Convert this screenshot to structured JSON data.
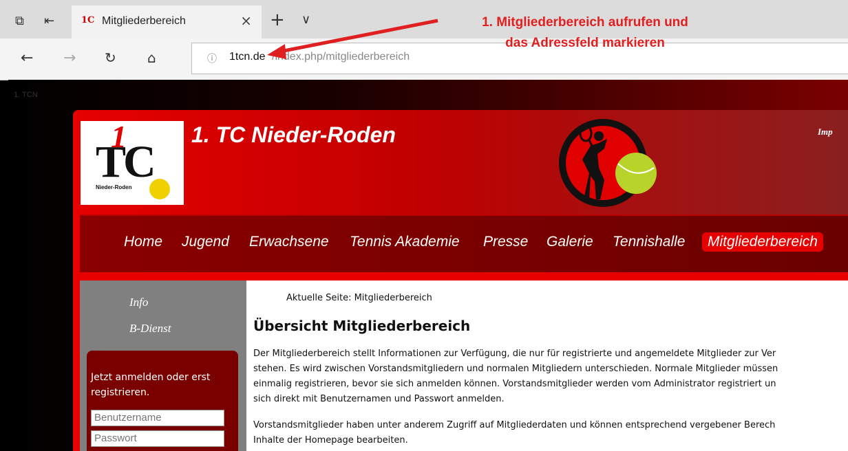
{
  "browser": {
    "tab_title": "Mitgliederbereich",
    "tab_favicon": "1C",
    "tab_close_icon": "×",
    "new_tab_icon": "+",
    "tab_menu_icon": "∨",
    "url_info_icon": "ⓘ",
    "url_domain": "1tcn.de",
    "url_path": "/index.php/mitgliederbereich"
  },
  "annotation": {
    "line1": "1. Mitgliederbereich aufrufen und",
    "line2": "das Adressfeld markieren",
    "color": "#e02020"
  },
  "site": {
    "faint_text": "1. TCN",
    "club_name": "1. TC Nieder-Roden",
    "logo_main": "TC",
    "logo_one": "1",
    "logo_sub": "Nieder-Roden",
    "impressum_partial": "Imp",
    "nav": [
      "Home",
      "Jugend",
      "Erwachsene",
      "Tennis Akademie",
      "Presse",
      "Galerie",
      "Tennishalle",
      "Mitgliederbereich"
    ],
    "sidebar_links": [
      "Info",
      "B-Dienst"
    ],
    "login": {
      "text": "Jetzt anmelden oder erst registrieren.",
      "username_placeholder": "Benutzername",
      "password_placeholder": "Passwort"
    },
    "breadcrumb": "Aktuelle Seite:  Mitgliederbereich",
    "page_title": "Übersicht Mitgliederbereich",
    "para1_lines": [
      "Der Mitgliederbereich stellt Informationen zur Verfügung, die nur für registrierte und angemeldete Mitglieder zur Ver",
      "stehen. Es wird zwischen Vorstandsmitgliedern und normalen Mitgliedern unterschieden. Normale Mitglieder müssen",
      "einmalig registrieren, bevor sie sich anmelden können. Vorstandsmitglieder werden vom Administrator registriert un",
      "sich direkt mit Benutzernamen und Passwort anmelden."
    ],
    "para2_lines": [
      "Vorstandsmitglieder haben unter anderem Zugriff auf Mitgliederdaten und können entsprechend vergebener Berech",
      "Inhalte der Homepage bearbeiten."
    ],
    "accent": "#e60000"
  }
}
